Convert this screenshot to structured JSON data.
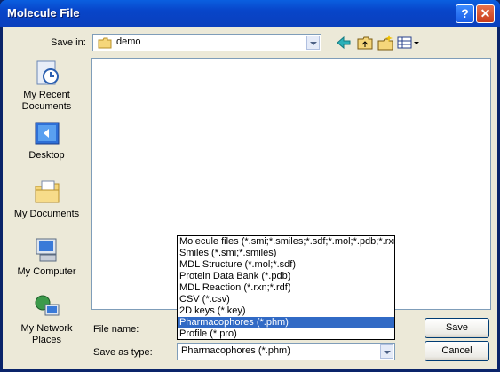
{
  "window": {
    "title": "Molecule File"
  },
  "save_in": {
    "label": "Save in:",
    "value": "demo"
  },
  "places": [
    {
      "label": "My Recent Documents"
    },
    {
      "label": "Desktop"
    },
    {
      "label": "My Documents"
    },
    {
      "label": "My Computer"
    },
    {
      "label": "My Network Places"
    }
  ],
  "file_name": {
    "label": "File name:",
    "value": ""
  },
  "save_as_type": {
    "label": "Save as type:",
    "value": "Pharmacophores (*.phm)",
    "options": [
      "Molecule files (*.smi;*.smiles;*.sdf;*.mol;*.pdb;*.rxn;*.",
      "Smiles (*.smi;*.smiles)",
      "MDL Structure (*.mol;*.sdf)",
      "Protein Data Bank (*.pdb)",
      "MDL Reaction (*.rxn;*.rdf)",
      "CSV (*.csv)",
      "2D keys (*.key)",
      "Pharmacophores (*.phm)",
      "Profile (*.pro)"
    ],
    "selected_index": 7
  },
  "buttons": {
    "save": "Save",
    "cancel": "Cancel"
  },
  "title_buttons": {
    "help": "?",
    "close": "✕"
  },
  "toolbar_icons": [
    "back-icon",
    "up-folder-icon",
    "new-folder-icon",
    "views-menu-icon"
  ]
}
